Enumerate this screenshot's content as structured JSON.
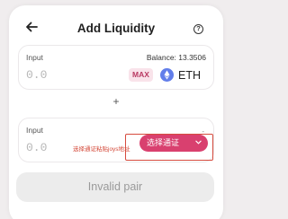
{
  "header": {
    "title": "Add Liquidity",
    "back_icon": "arrow-left-icon",
    "help_icon": "question-circle-icon",
    "help_glyph": "?"
  },
  "input_a": {
    "label": "Input",
    "balance": "Balance: 13.3506",
    "amount_placeholder": "0.0",
    "max_label": "MAX",
    "token": "ETH",
    "token_icon": "ethereum-icon"
  },
  "plus": "+",
  "input_b": {
    "label": "Input",
    "balance": "-",
    "amount_placeholder": "0.0",
    "annotation": "选择通证粘贴joys地址",
    "select_label": "选择通证"
  },
  "submit_label": "Invalid pair",
  "colors": {
    "accent": "#d9406f",
    "annotation": "#d64b3e",
    "eth": "#627eea"
  }
}
